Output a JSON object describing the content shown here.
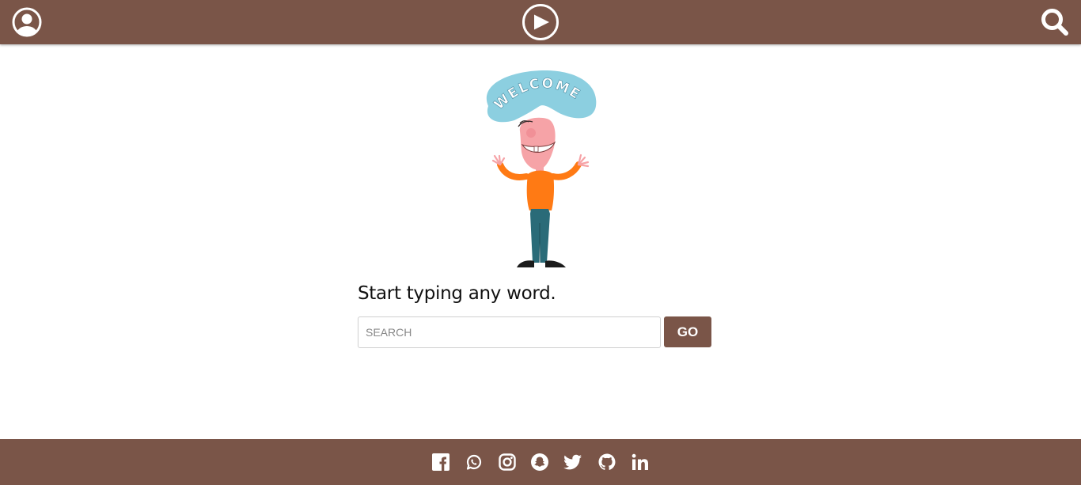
{
  "header": {
    "icons": [
      "user-circle-icon",
      "play-circle-icon",
      "search-icon"
    ],
    "bar_color": "#7a5548"
  },
  "hero": {
    "banner_text": "WELCOME",
    "banner_color": "#8ccfe0",
    "shirt_color": "#ff7a14",
    "pants_color": "#2a6b78",
    "skin_color": "#f6a3a7"
  },
  "main": {
    "prompt": "Start typing any word.",
    "search": {
      "placeholder": "SEARCH",
      "value": ""
    },
    "go_label": "GO"
  },
  "footer": {
    "social_icons": [
      "facebook-icon",
      "whatsapp-icon",
      "instagram-icon",
      "snapchat-icon",
      "twitter-icon",
      "github-icon",
      "linkedin-icon"
    ],
    "bar_color": "#7a5548"
  }
}
